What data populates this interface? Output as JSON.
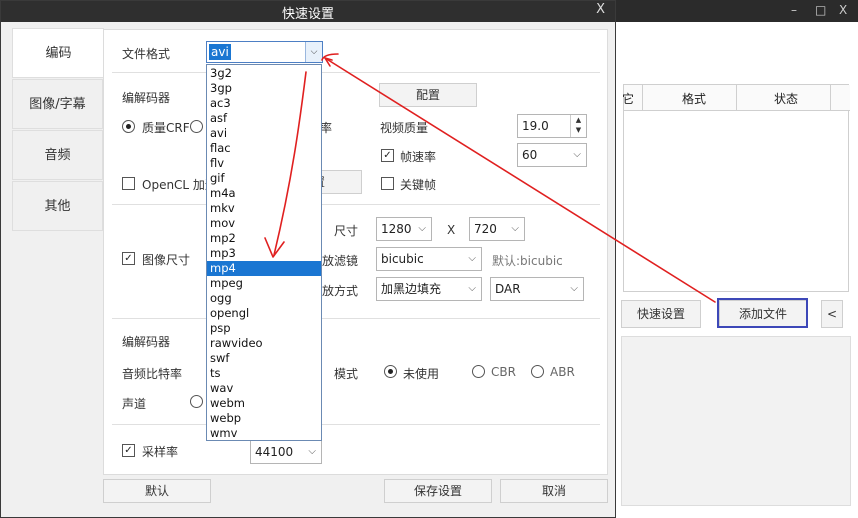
{
  "background_window": {
    "controls": [
      "–",
      "□",
      "X"
    ],
    "table_headers": [
      "它",
      "格式",
      "状态"
    ],
    "buttons": [
      "快速设置",
      "添加文件",
      "<"
    ]
  },
  "dialog": {
    "title": "快速设置",
    "close": "X",
    "tabs": [
      "编码",
      "图像/字幕",
      "音频",
      "其他"
    ],
    "video": {
      "file_format_label": "文件格式",
      "file_format_value": "avi",
      "codec_label": "编解码器",
      "config_button": "配置",
      "quality_crf_label": "质量CRF",
      "bitrate_partial": "率",
      "video_quality_label": "视频质量",
      "video_quality_value": "19.0",
      "frame_rate_label": "帧速率",
      "frame_rate_value": "60",
      "opencl_label": "OpenCL 加速",
      "settings_partial": "置",
      "keyframe_label": "关键帧"
    },
    "image": {
      "size_label": "图像尺寸",
      "size_partial": "尺寸",
      "width": "1280",
      "x_sep": "X",
      "height": "720",
      "filter_partial": "放滤镜",
      "filter_value": "bicubic",
      "filter_default": "默认:bicubic",
      "scale_partial": "放方式",
      "scale_value": "加黑边填充",
      "aspect_value": "DAR"
    },
    "audio": {
      "codec_label": "编解码器",
      "bitrate_label": "音频比特率",
      "mode_label": "模式",
      "mode_options": [
        "未使用",
        "CBR",
        "ABR"
      ],
      "channel_label": "声道",
      "samplerate_label": "采样率",
      "samplerate_value": "44100"
    },
    "footer": {
      "default_button": "默认",
      "save_button": "保存设置",
      "cancel_button": "取消"
    },
    "format_options": [
      "3g2",
      "3gp",
      "ac3",
      "asf",
      "avi",
      "flac",
      "flv",
      "gif",
      "m4a",
      "mkv",
      "mov",
      "mp2",
      "mp3",
      "mp4",
      "mpeg",
      "ogg",
      "opengl",
      "psp",
      "rawvideo",
      "swf",
      "ts",
      "wav",
      "webm",
      "webp",
      "wmv"
    ],
    "format_selected": "mp4"
  },
  "colors": {
    "accent": "#1a76d2",
    "annotation": "#e02020",
    "highlight_box": "#3d48b8"
  }
}
